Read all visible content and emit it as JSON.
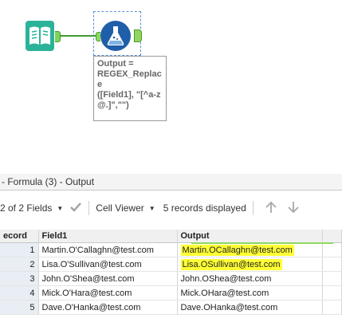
{
  "workflow": {
    "annotation": "Output =\nREGEX_Replace\n([Field1], \"[^a-z@.]\",\"\")"
  },
  "results": {
    "title": "- Formula (3) - Output",
    "toolbar": {
      "fields_label": "2 of 2 Fields",
      "cell_viewer_label": "Cell Viewer",
      "records_label": "5 records displayed"
    },
    "columns": [
      "ecord",
      "Field1",
      "Output"
    ],
    "rows": [
      {
        "record": "1",
        "field1": "Martin.O'Callaghn@test.com",
        "output": "Martin.OCallaghn@test.com",
        "highlight": true
      },
      {
        "record": "2",
        "field1": "Lisa.O'Sullivan@test.com",
        "output": "Lisa.OSullivan@test.com",
        "highlight": true
      },
      {
        "record": "3",
        "field1": "John.O'Shea@test.com",
        "output": "John.OShea@test.com",
        "highlight": false
      },
      {
        "record": "4",
        "field1": "Mick.O'Hara@test.com",
        "output": "Mick.OHara@test.com",
        "highlight": false
      },
      {
        "record": "5",
        "field1": "Dave.O'Hanka@test.com",
        "output": "Dave.OHanka@test.com",
        "highlight": false
      }
    ]
  },
  "colors": {
    "input_tool": "#2bb39a",
    "formula_tool": "#1f5ea8",
    "connector": "#3f9a2e",
    "highlight": "#ffff33"
  }
}
